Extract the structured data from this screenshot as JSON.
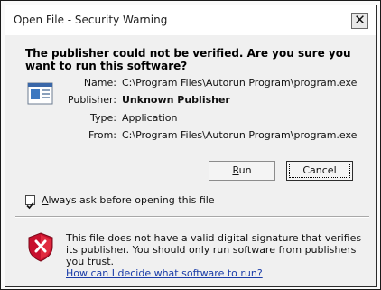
{
  "window": {
    "title": "Open File - Security Warning",
    "close_glyph": "✕"
  },
  "heading": "The publisher could not be verified.  Are you sure you want to run this software?",
  "file_icon": "program-file-icon",
  "details": [
    {
      "label": "Name:",
      "value": "C:\\Program Files\\Autorun Program\\program.exe",
      "bold": false
    },
    {
      "label": "Publisher:",
      "value": "Unknown Publisher",
      "bold": true
    },
    {
      "label": "Type:",
      "value": "Application",
      "bold": false
    },
    {
      "label": "From:",
      "value": "C:\\Program Files\\Autorun Program\\program.exe",
      "bold": false
    }
  ],
  "buttons": {
    "run": {
      "mnemonic": "R",
      "rest": "un"
    },
    "cancel": "Cancel"
  },
  "checkbox": {
    "checked": true,
    "mnemonic": "A",
    "rest": "lways ask before opening this file"
  },
  "warning": {
    "icon": "shield-error-icon",
    "text": "This file does not have a valid digital signature that verifies its publisher.  You should only run software from publishers you trust.",
    "link": "How can I decide what software to run?"
  },
  "colors": {
    "link": "#1a3ca8",
    "shield_red": "#c8102e"
  }
}
